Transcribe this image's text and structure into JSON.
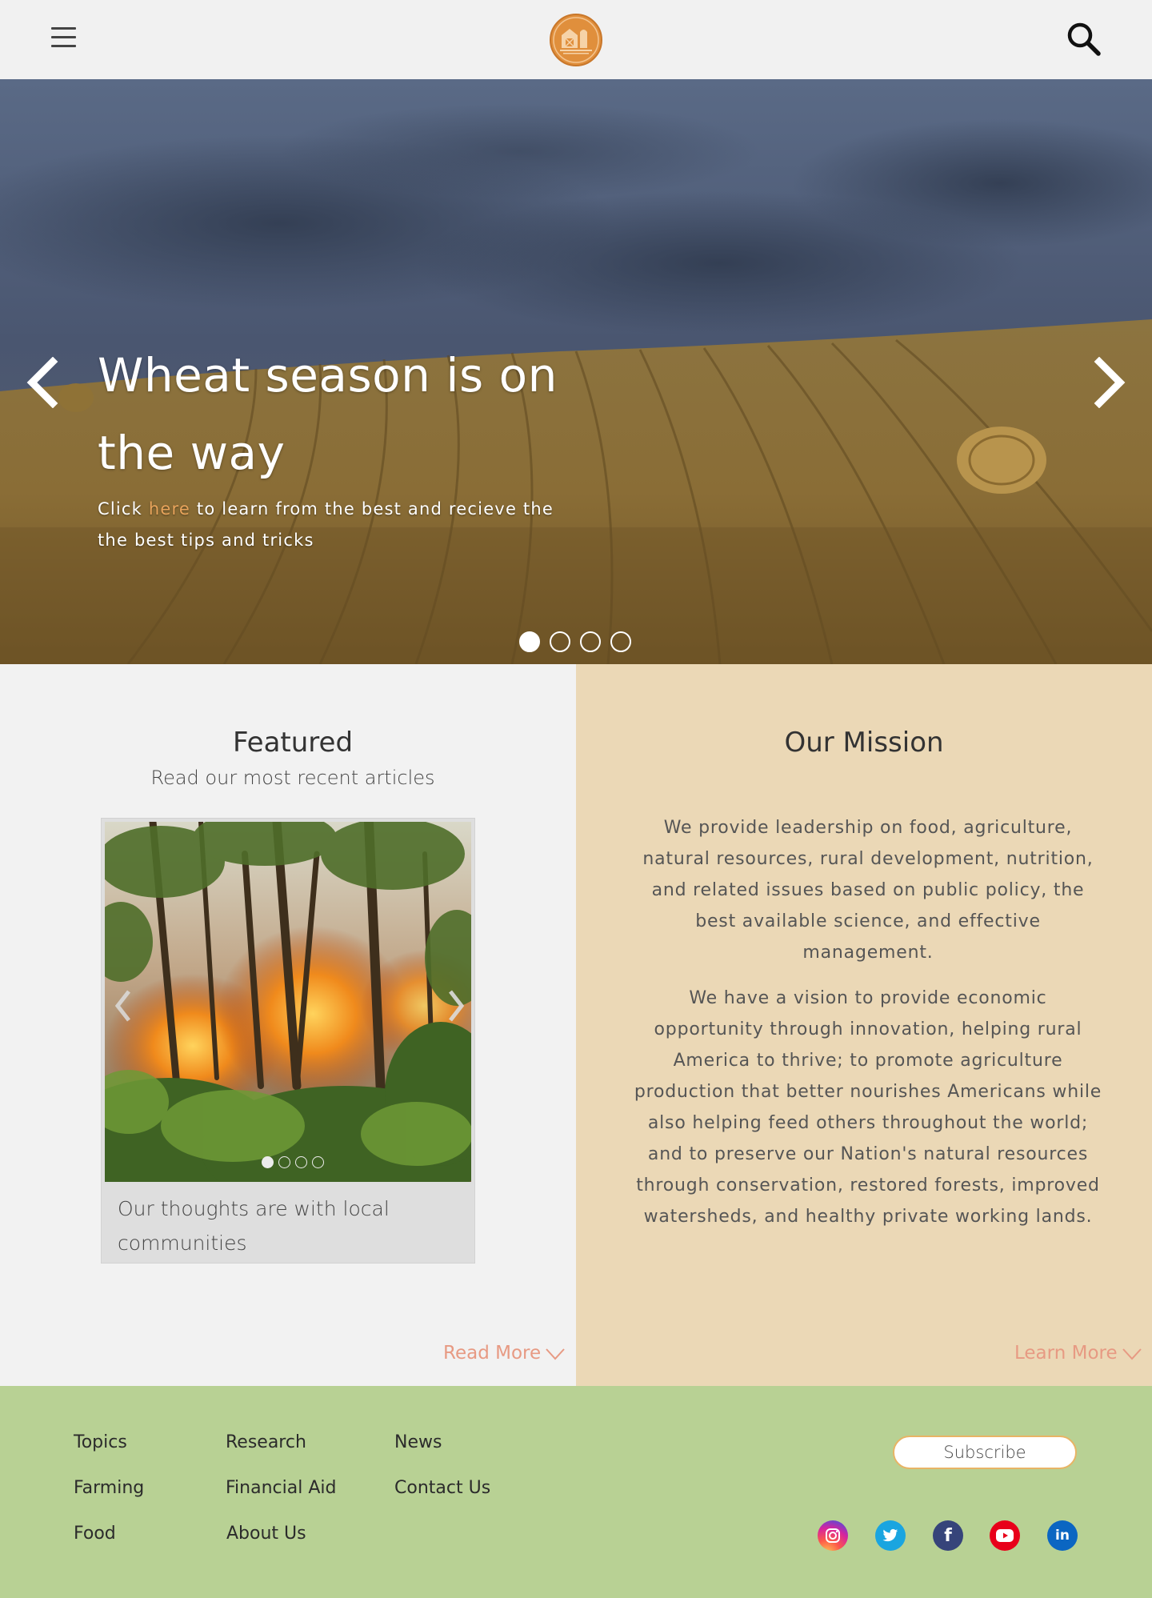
{
  "header": {
    "menu_icon": "hamburger-icon",
    "logo": "barn-silo-logo",
    "search_icon": "search-icon"
  },
  "hero": {
    "title": "Wheat season is on the way",
    "subtitle_before": "Click ",
    "subtitle_link": "here",
    "subtitle_after": " to learn from the best and recieve the the best tips and tricks",
    "slide_count": 4,
    "active_slide": 1,
    "prev_icon": "chevron-left-icon",
    "next_icon": "chevron-right-icon"
  },
  "featured": {
    "title": "Featured",
    "subtitle": "Read our most recent articles",
    "card": {
      "caption": "Our thoughts are with local communities",
      "image": "forest-fire-photo",
      "slide_count": 4,
      "active_slide": 1
    },
    "read_more": "Read More"
  },
  "mission": {
    "title": "Our Mission",
    "paragraph_1": "We provide leadership on food, agriculture, natural resources, rural development, nutrition, and related issues based on public policy, the best available science, and effective management.",
    "paragraph_2": "We have a vision to provide economic opportunity through innovation, helping rural America to thrive; to promote agriculture production that better nourishes Americans while also helping feed others throughout the world; and to preserve our Nation's natural resources through conservation, restored forests, improved watersheds, and healthy private working lands.",
    "learn_more": "Learn More"
  },
  "footer": {
    "col1": [
      "Topics",
      "Farming",
      "Food"
    ],
    "col2": [
      "Research",
      "Financial Aid",
      "About Us"
    ],
    "col3": [
      "News",
      "Contact Us"
    ],
    "subscribe": "Subscribe",
    "social": [
      "instagram-icon",
      "twitter-icon",
      "facebook-icon",
      "youtube-icon",
      "linkedin-icon"
    ]
  },
  "colors": {
    "accent_orange": "#e8a45b",
    "link_salmon": "#e79a83",
    "mission_bg": "#ebd8b6",
    "footer_bg": "#b8d194",
    "header_bg": "#f1f1f1"
  }
}
